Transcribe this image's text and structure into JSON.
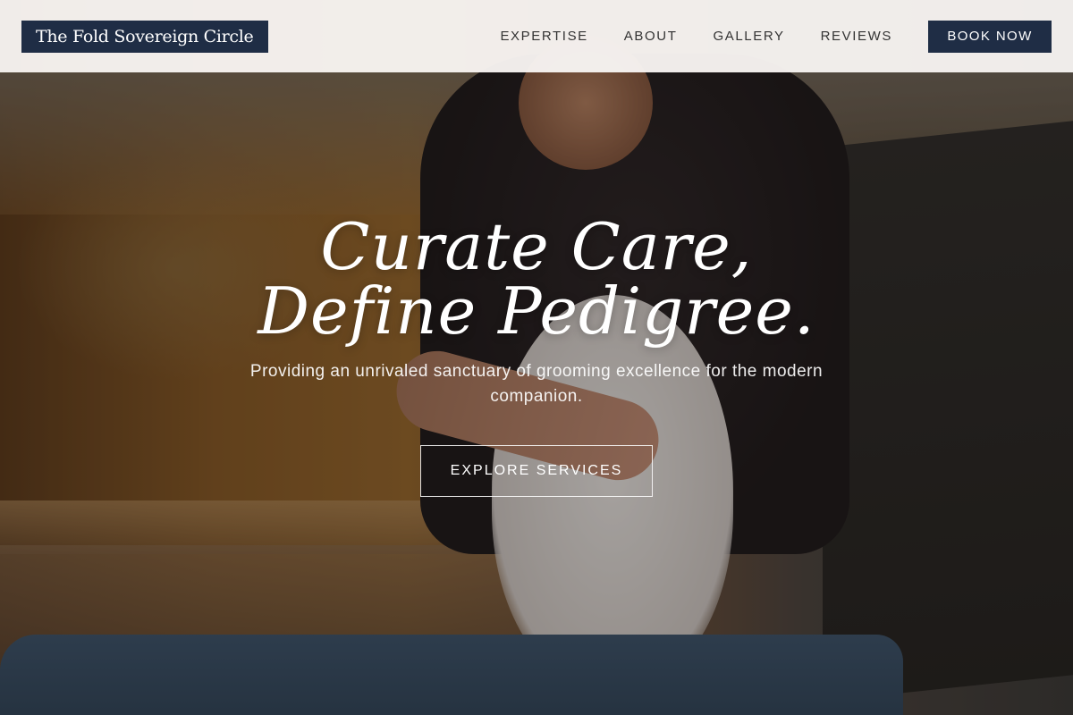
{
  "brand": {
    "name": "The Fold Sovereign Circle"
  },
  "nav": {
    "items": [
      "EXPERTISE",
      "ABOUT",
      "GALLERY",
      "REVIEWS"
    ],
    "cta_label": "BOOK NOW"
  },
  "hero": {
    "headline_line1": "Curate Care,",
    "headline_line2": "Define Pedigree.",
    "subheadline": "Providing an unrivaled sanctuary of grooming excellence for the modern companion.",
    "cta_label": "EXPLORE SERVICES",
    "background_image": "groomer-combing-white-pomeranian"
  },
  "colors": {
    "brand_navy": "#1f2d45",
    "header_bg": "#f8f5f3",
    "text_dark": "#333333"
  }
}
